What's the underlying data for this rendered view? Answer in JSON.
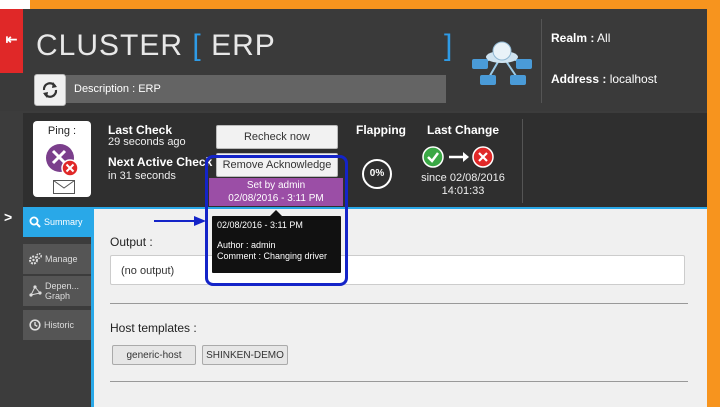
{
  "header": {
    "title_text": "CLUSTER",
    "title_bracket_left": "[",
    "title_sub": "ERP",
    "title_bracket_right": "]",
    "description": "Description : ERP",
    "realm_label": "Realm :",
    "realm_value": "All",
    "address_label": "Address :",
    "address_value": "localhost",
    "side_tab_glyph": "⇤"
  },
  "status": {
    "ping_label": "Ping :",
    "last_check_title": "Last Check",
    "last_check_ago": "29 seconds ago",
    "next_check_title": "Next Active Check",
    "next_check_in": "in 31 seconds",
    "recheck_label": "Recheck now",
    "remove_ack_label": "Remove Acknowledge",
    "ack_set_by": "Set by admin",
    "ack_set_date": "02/08/2016 - 3:11 PM",
    "flapping_title": "Flapping",
    "flapping_value": "0%",
    "last_change_title": "Last Change",
    "last_change_since": "since 02/08/2016",
    "last_change_time": "14:01:33"
  },
  "tooltip": {
    "date": "02/08/2016 - 3:11 PM",
    "author": "Author : admin",
    "comment": "Comment : Changing driver"
  },
  "nav": {
    "expand_glyph": ">",
    "items": [
      {
        "label": "Summary",
        "icon": "search-icon",
        "active": true
      },
      {
        "label": "Manage",
        "icon": "gears-icon",
        "active": false
      },
      {
        "label": "Depen... Graph",
        "icon": "graph-icon",
        "active": false
      },
      {
        "label": "Historic",
        "icon": "clock-icon",
        "active": false
      }
    ]
  },
  "content": {
    "output_label": "Output :",
    "output_value": "(no output)",
    "host_templates_label": "Host templates :",
    "templates": [
      "generic-host",
      "SHINKEN-DEMO"
    ]
  },
  "colors": {
    "accent_blue": "#29a8e8",
    "alert_red": "#e02828",
    "ack_purple": "#9b4ea6",
    "frame_orange": "#f7941e",
    "annotation_blue": "#1424c8"
  }
}
